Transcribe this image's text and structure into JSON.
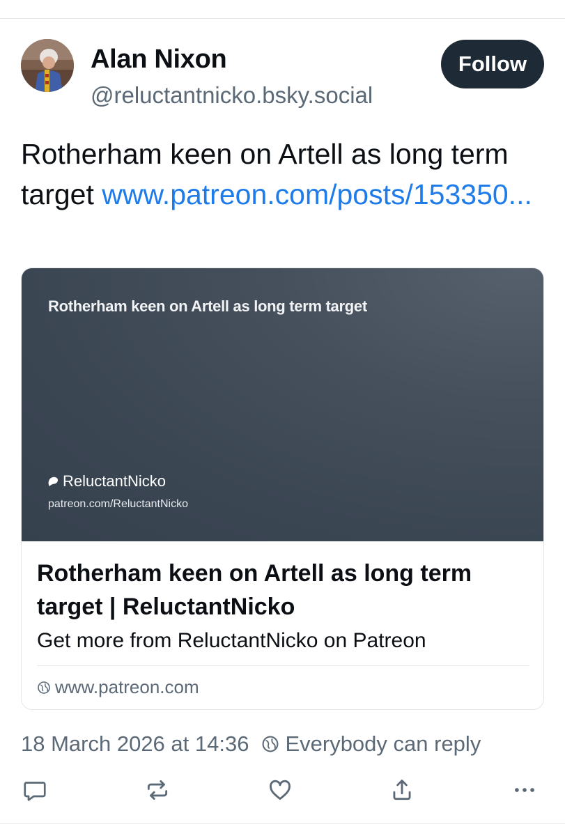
{
  "author": {
    "name": "Alan Nixon",
    "handle": "@reluctantnicko.bsky.social"
  },
  "follow_label": "Follow",
  "post": {
    "text": "Rotherham keen on Artell as long term target ",
    "link_text": "www.patreon.com/posts/153350..."
  },
  "card": {
    "thumbnail_title": "Rotherham keen on Artell as long term target",
    "thumbnail_brand": "ReluctantNicko",
    "thumbnail_url": "patreon.com/ReluctantNicko",
    "title": "Rotherham keen on Artell as long term target | ReluctantNicko",
    "description": "Get more from ReluctantNicko on Patreon",
    "domain": "www.patreon.com"
  },
  "meta": {
    "timestamp": "18 March 2026 at 14:36",
    "reply_setting": "Everybody can reply"
  },
  "actions": {
    "icons": [
      "comment-icon",
      "repost-icon",
      "like-icon",
      "share-icon",
      "more-icon"
    ]
  },
  "colors": {
    "link": "#1d7bea",
    "follow_bg": "#1f2a37",
    "muted": "#5b6976",
    "card_image_bg": "#3b4653"
  }
}
